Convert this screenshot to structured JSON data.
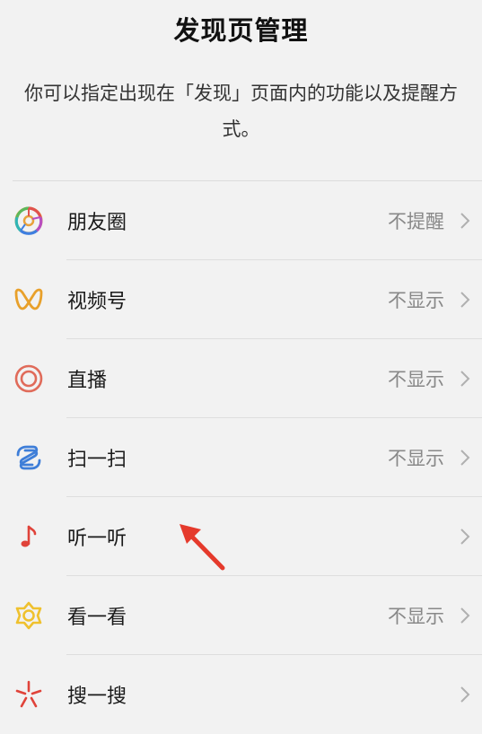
{
  "header": {
    "title": "发现页管理",
    "description": "你可以指定出现在「发现」页面内的功能以及提醒方式。"
  },
  "items": [
    {
      "label": "朋友圈",
      "status": "不提醒",
      "icon": "moments-icon"
    },
    {
      "label": "视频号",
      "status": "不显示",
      "icon": "channels-icon"
    },
    {
      "label": "直播",
      "status": "不显示",
      "icon": "live-icon"
    },
    {
      "label": "扫一扫",
      "status": "不显示",
      "icon": "scan-icon"
    },
    {
      "label": "听一听",
      "status": "",
      "icon": "music-note-icon"
    },
    {
      "label": "看一看",
      "status": "不显示",
      "icon": "top-stories-icon"
    },
    {
      "label": "搜一搜",
      "status": "",
      "icon": "search-icon"
    }
  ],
  "colors": {
    "background": "#f2f2f2",
    "annotation_arrow": "#e53a2c",
    "status_text": "#888888"
  }
}
